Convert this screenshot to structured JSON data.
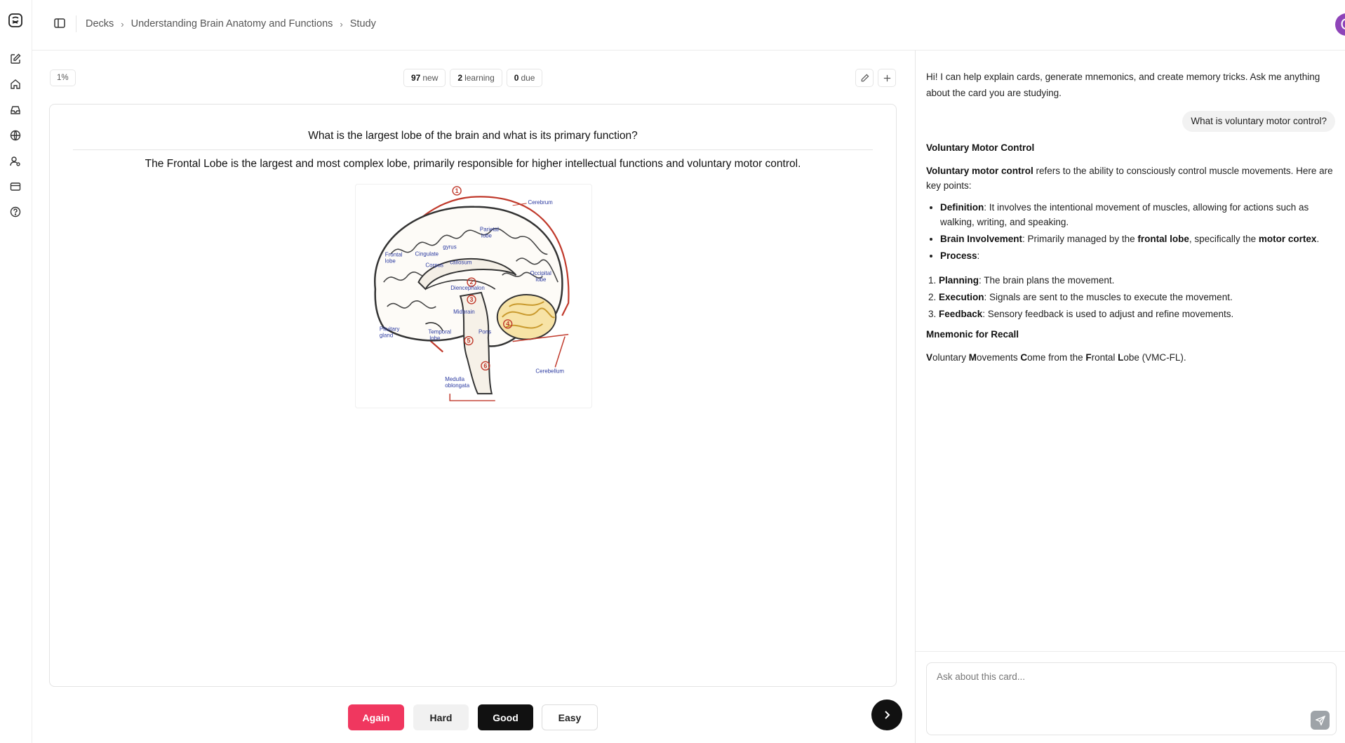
{
  "rail": {
    "items": [
      "logo-icon",
      "edit-icon",
      "home-icon",
      "inbox-icon",
      "globe-icon",
      "user-settings-icon",
      "card-icon",
      "help-icon"
    ]
  },
  "breadcrumb": {
    "decks": "Decks",
    "deck_name": "Understanding Brain Anatomy and Functions",
    "current": "Study"
  },
  "user": {
    "avatar_letter": "O",
    "avatar_color": "#8e44b8"
  },
  "progress": {
    "percent_label": "1%"
  },
  "counts": {
    "new_num": "97",
    "new_label": "new",
    "learning_num": "2",
    "learning_label": "learning",
    "due_num": "0",
    "due_label": "due"
  },
  "card": {
    "question": "What is the largest lobe of the brain and what is its primary function?",
    "answer": "The Frontal Lobe is the largest and most complex lobe, primarily responsible for higher intellectual functions and voluntary motor control.",
    "diagram_labels": {
      "cerebrum": "Cerebrum",
      "parietal_1": "Parietal",
      "parietal_2": "lobe",
      "frontal_1": "Frontal",
      "frontal_2": "lobe",
      "cingulate": "Cingulate",
      "gyrus": "gyrus",
      "corpus": "Corpus",
      "callosum": "callosum",
      "occipital_1": "Occipital",
      "occipital_2": "lobe",
      "diencephalon": "Diencephalon",
      "midbrain": "Midbrain",
      "pituitary_1": "Pituitary",
      "pituitary_2": "gland",
      "temporal_1": "Temporal",
      "temporal_2": "lobe",
      "pons": "Pons",
      "cerebellum": "Cerebellum",
      "medulla_1": "Medulla",
      "medulla_2": "oblongata",
      "n1": "1",
      "n2": "2",
      "n3": "3",
      "n4": "4",
      "n5": "5",
      "n6": "6"
    }
  },
  "grading": {
    "again": "Again",
    "hard": "Hard",
    "good": "Good",
    "easy": "Easy"
  },
  "colors": {
    "again": "#f0375f",
    "good": "#111111",
    "diagram_outline": "#c0392b",
    "diagram_label": "#2b3aa0"
  },
  "chat": {
    "intro": "Hi! I can help explain cards, generate mnemonics, and create memory tricks. Ask me anything about the card you are studying.",
    "user_message": "What is voluntary motor control?",
    "response": {
      "heading": "Voluntary Motor Control",
      "intro_bold": "Voluntary motor control",
      "intro_rest": " refers to the ability to consciously control muscle movements. Here are key points:",
      "bullets": [
        {
          "bold": "Definition",
          "text": ": It involves the intentional movement of muscles, allowing for actions such as walking, writing, and speaking."
        },
        {
          "bold": "Brain Involvement",
          "text_1": ": Primarily managed by the ",
          "bold_2": "frontal lobe",
          "text_2": ", specifically the ",
          "bold_3": "motor cortex",
          "text_3": "."
        },
        {
          "bold": "Process",
          "text": ":"
        }
      ],
      "steps": [
        {
          "bold": "Planning",
          "text": ": The brain plans the movement."
        },
        {
          "bold": "Execution",
          "text": ": Signals are sent to the muscles to execute the movement."
        },
        {
          "bold": "Feedback",
          "text": ": Sensory feedback is used to adjust and refine movements."
        }
      ],
      "mnemonic_heading": "Mnemonic for Recall",
      "mnemonic": {
        "v": "V",
        "v_rest": "oluntary ",
        "m": "M",
        "m_rest": "ovements ",
        "c": "C",
        "c_rest": "ome from the ",
        "f": "F",
        "f_rest": "rontal ",
        "l": "L",
        "l_rest": "obe (VMC-FL)."
      }
    },
    "input_placeholder": "Ask about this card..."
  }
}
